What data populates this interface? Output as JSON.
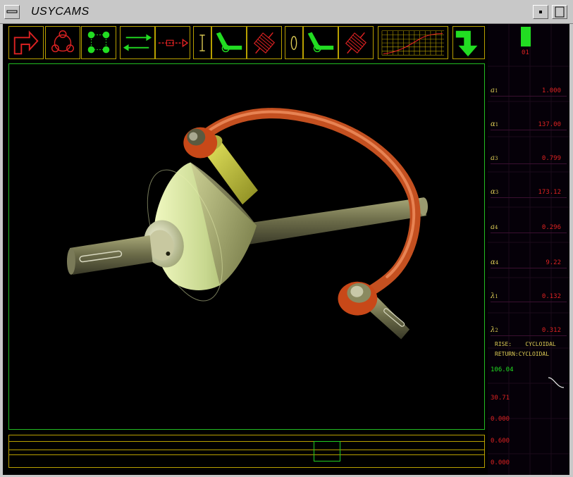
{
  "window": {
    "title": "USYCAMS",
    "menu_icon": "window-menu-icon",
    "minimize_icon": "minimize-icon",
    "maximize_icon": "maximize-icon"
  },
  "toolbar": {
    "tools": [
      {
        "name": "cam-orientation-tool",
        "icon": "red-bent-arrow-icon"
      },
      {
        "name": "circle-pattern-tool",
        "icon": "red-three-circles-icon"
      },
      {
        "name": "square-pattern-tool",
        "icon": "green-four-dots-icon"
      },
      {
        "name": "green-arrows-tool",
        "icon": "green-double-arrow-icon"
      },
      {
        "name": "red-arrows-tool",
        "icon": "red-dashed-arrow-icon"
      },
      {
        "name": "translating-follower-tool",
        "icon": "i-beam-icon"
      },
      {
        "name": "oscillating-follower-green-tool",
        "icon": "green-lever-icon"
      },
      {
        "name": "roller-follower-red-tool",
        "icon": "red-roller-icon"
      },
      {
        "name": "rotating-follower-tool",
        "icon": "ellipse-icon"
      },
      {
        "name": "oscillating-follower-green2-tool",
        "icon": "green-lever-icon"
      },
      {
        "name": "roller-follower-red2-tool",
        "icon": "red-roller-icon"
      },
      {
        "name": "displacement-graph-tool",
        "icon": "graph-grid-icon"
      },
      {
        "name": "exit-tool",
        "icon": "green-down-arrow-icon"
      }
    ]
  },
  "indicator": {
    "counter": "01"
  },
  "parameters": [
    {
      "symbol": "a",
      "subscript": "1",
      "value": "1.000"
    },
    {
      "symbol": "α",
      "subscript": "1",
      "value": "137.00"
    },
    {
      "symbol": "a",
      "subscript": "3",
      "value": "0.799"
    },
    {
      "symbol": "α",
      "subscript": "3",
      "value": "173.12"
    },
    {
      "symbol": "a",
      "subscript": "4",
      "value": "0.296"
    },
    {
      "symbol": "α",
      "subscript": "4",
      "value": "9.22"
    },
    {
      "symbol": "λ",
      "subscript": "1",
      "value": "0.132"
    },
    {
      "symbol": "λ",
      "subscript": "2",
      "value": "0.312"
    }
  ],
  "motion": {
    "rise_label": "RISE:",
    "rise_value": "CYCLOIDAL",
    "return_label": "RETURN:",
    "return_value": "CYCLOIDAL"
  },
  "readouts": {
    "green_value": "106.04",
    "red_value_1": "30.71",
    "red_value_2": "0.000",
    "red_value_3": "0.600",
    "red_value_4": "0.000"
  },
  "slider": {
    "position": 0.66
  },
  "colors": {
    "border_yellow": "#b8a000",
    "border_green": "#22bb22",
    "red": "#dd2222",
    "green": "#22dd22",
    "label_yellow": "#ddcc55"
  }
}
